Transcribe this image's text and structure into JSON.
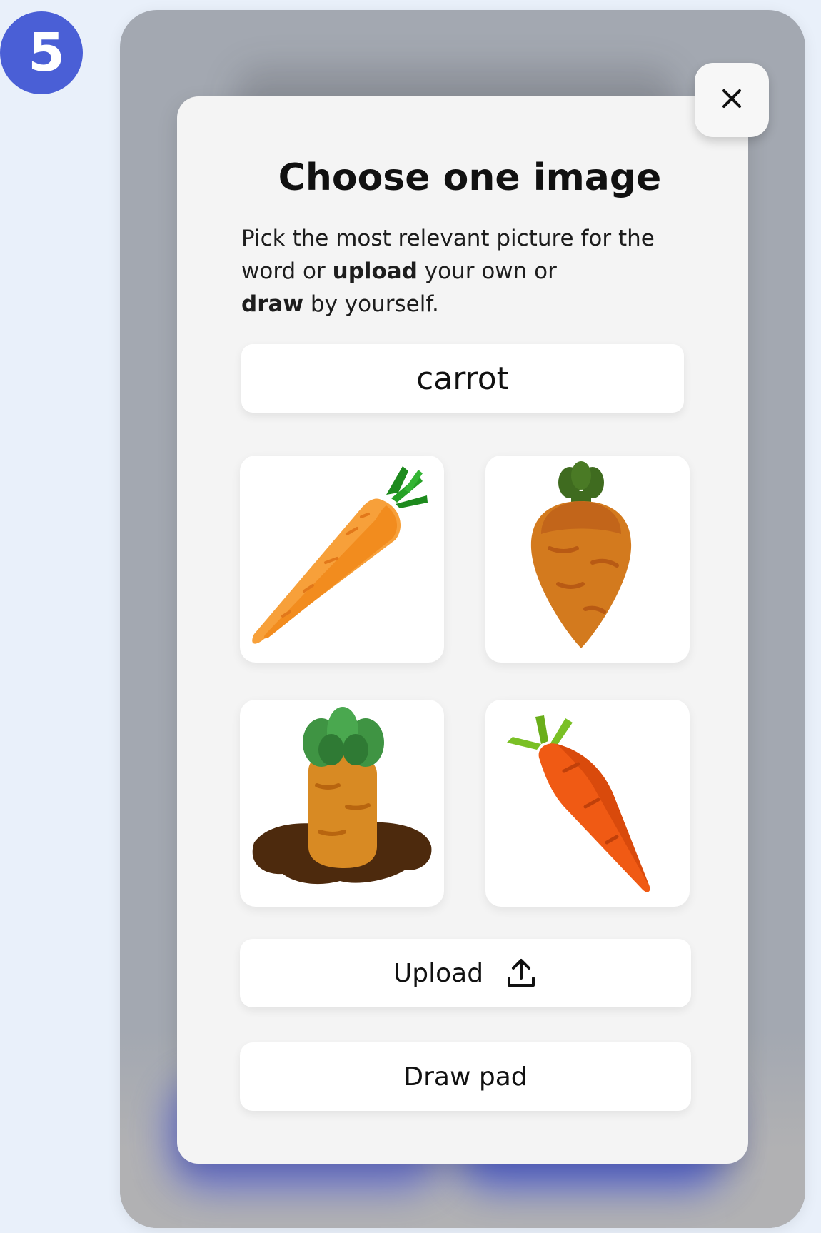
{
  "step": {
    "number": "5"
  },
  "modal": {
    "title": "Choose one image",
    "description_parts": [
      "Pick the most relevant picture for the word or ",
      "upload",
      " your own or ",
      "draw",
      " by yourself."
    ],
    "word": "carrot",
    "images": [
      {
        "icon": "carrot-diagonal-image"
      },
      {
        "icon": "carrot-upright-image"
      },
      {
        "icon": "carrot-in-ground-image"
      },
      {
        "icon": "carrot-red-image"
      }
    ],
    "upload_label": "Upload",
    "draw_label": "Draw pad"
  },
  "colors": {
    "accent": "#4a5fd6",
    "modal_bg": "#f4f4f4",
    "overlay": "#a3a8b1"
  }
}
